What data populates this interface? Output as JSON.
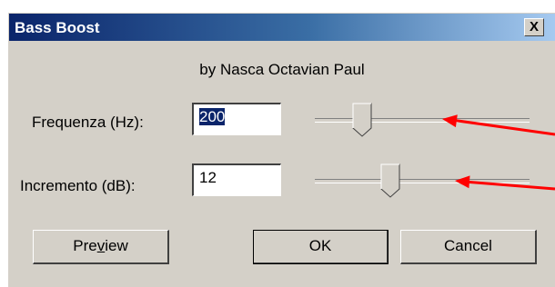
{
  "window": {
    "title": "Bass Boost",
    "close_label": "X"
  },
  "subtitle": "by Nasca Octavian Paul",
  "frequency": {
    "label": "Frequenza (Hz):",
    "value": "200",
    "slider_value": 0.22
  },
  "boost": {
    "label": "Incremento (dB):",
    "value": "12",
    "slider_value": 0.35
  },
  "buttons": {
    "preview_before": "Pre",
    "preview_underline": "v",
    "preview_after": "iew",
    "ok": "OK",
    "cancel": "Cancel"
  },
  "colors": {
    "annotation_arrow": "#ff0000"
  }
}
